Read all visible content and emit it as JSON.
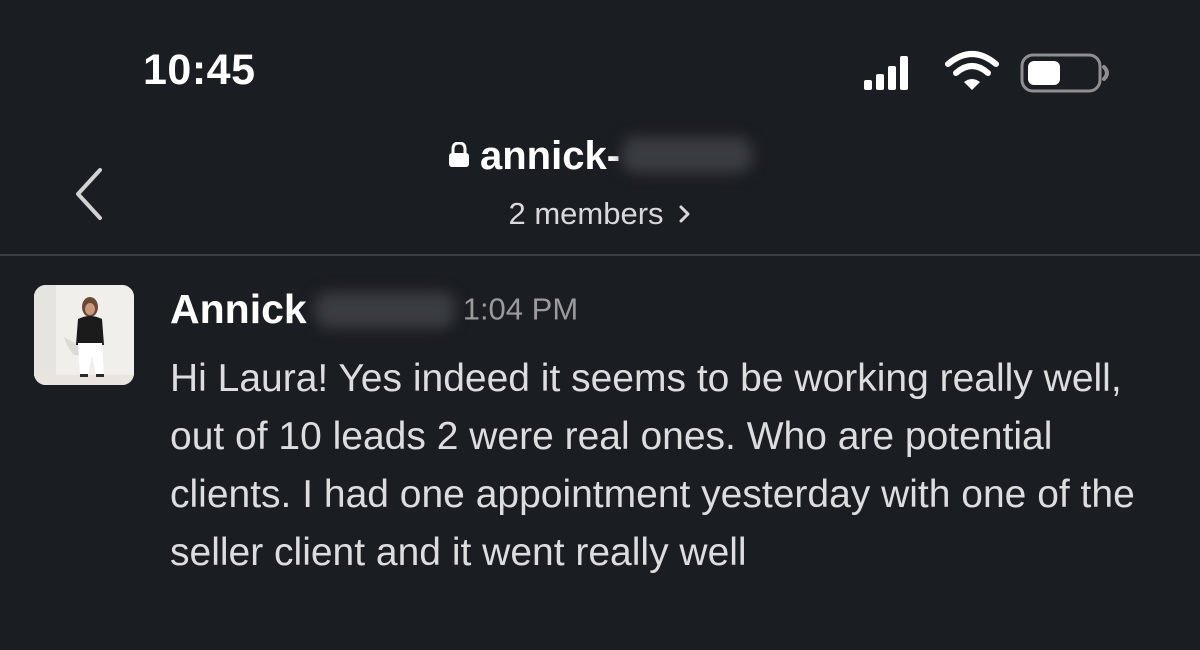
{
  "status_bar": {
    "time": "10:45",
    "icons": [
      "signal-icon",
      "wifi-icon",
      "battery-icon"
    ]
  },
  "header": {
    "channel_name": "annick-",
    "members": "2 members",
    "icons": [
      "back-chevron-icon",
      "lock-icon",
      "chevron-right-icon"
    ]
  },
  "message": {
    "sender": "Annick",
    "timestamp": "1:04 PM",
    "text": "Hi Laura! Yes indeed it seems to be working really well, out of 10 leads 2 were real ones. Who are potential clients. I had one appointment yesterday with one of the seller client and it went really well"
  },
  "colors": {
    "background": "#1a1d21",
    "text_primary": "#ffffff",
    "text_secondary": "#9a9b9d",
    "divider": "#3b3e43"
  }
}
